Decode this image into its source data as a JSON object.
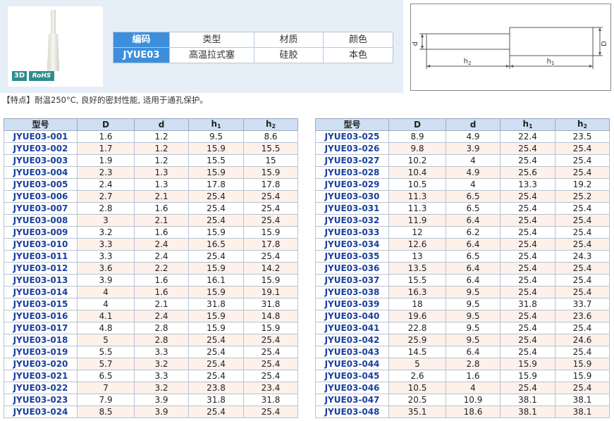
{
  "badges": {
    "three_d": "3D",
    "rohs": "RoHS"
  },
  "info_table": {
    "headers": [
      "编码",
      "类型",
      "材质",
      "颜色"
    ],
    "row": [
      "JYUE03",
      "高温拉式塞",
      "硅胶",
      "本色"
    ]
  },
  "drawing": {
    "d_label": "d",
    "D_label": "D",
    "h1_label": "h",
    "h1_sub": "1",
    "h2_label": "h",
    "h2_sub": "2"
  },
  "feature_note": "【特点】耐温250°C, 良好的密封性能, 适用于通孔保护。",
  "spec_headers": {
    "model": "型号",
    "D": "D",
    "d": "d",
    "h1": "h",
    "h1_sub": "1",
    "h2": "h",
    "h2_sub": "2"
  },
  "spec_left": [
    [
      "JYUE03-001",
      "1.6",
      "1.2",
      "9.5",
      "8.6"
    ],
    [
      "JYUE03-002",
      "1.7",
      "1.2",
      "15.9",
      "15.5"
    ],
    [
      "JYUE03-003",
      "1.9",
      "1.2",
      "15.5",
      "15"
    ],
    [
      "JYUE03-004",
      "2.3",
      "1.3",
      "15.9",
      "15.9"
    ],
    [
      "JYUE03-005",
      "2.4",
      "1.3",
      "17.8",
      "17.8"
    ],
    [
      "JYUE03-006",
      "2.7",
      "2.1",
      "25.4",
      "25.4"
    ],
    [
      "JYUE03-007",
      "2.8",
      "1.6",
      "25.4",
      "25.4"
    ],
    [
      "JYUE03-008",
      "3",
      "2.1",
      "25.4",
      "25.4"
    ],
    [
      "JYUE03-009",
      "3.2",
      "1.6",
      "15.9",
      "15.9"
    ],
    [
      "JYUE03-010",
      "3.3",
      "2.4",
      "16.5",
      "17.8"
    ],
    [
      "JYUE03-011",
      "3.3",
      "2.4",
      "25.4",
      "25.4"
    ],
    [
      "JYUE03-012",
      "3.6",
      "2.2",
      "15.9",
      "14.2"
    ],
    [
      "JYUE03-013",
      "3.9",
      "1.6",
      "16.1",
      "15.9"
    ],
    [
      "JYUE03-014",
      "4",
      "1.6",
      "15.9",
      "19.1"
    ],
    [
      "JYUE03-015",
      "4",
      "2.1",
      "31.8",
      "31.8"
    ],
    [
      "JYUE03-016",
      "4.1",
      "2.4",
      "15.9",
      "14.8"
    ],
    [
      "JYUE03-017",
      "4.8",
      "2.8",
      "15.9",
      "15.9"
    ],
    [
      "JYUE03-018",
      "5",
      "2.8",
      "25.4",
      "25.4"
    ],
    [
      "JYUE03-019",
      "5.5",
      "3.3",
      "25.4",
      "25.4"
    ],
    [
      "JYUE03-020",
      "5.7",
      "3.2",
      "25.4",
      "25.4"
    ],
    [
      "JYUE03-021",
      "6.5",
      "3.3",
      "25.4",
      "25.4"
    ],
    [
      "JYUE03-022",
      "7",
      "3.2",
      "23.8",
      "23.4"
    ],
    [
      "JYUE03-023",
      "7.9",
      "3.9",
      "31.8",
      "31.8"
    ],
    [
      "JYUE03-024",
      "8.5",
      "3.9",
      "25.4",
      "25.4"
    ]
  ],
  "spec_right": [
    [
      "JYUE03-025",
      "8.9",
      "4.9",
      "22.4",
      "23.5"
    ],
    [
      "JYUE03-026",
      "9.8",
      "3.9",
      "25.4",
      "25.4"
    ],
    [
      "JYUE03-027",
      "10.2",
      "4",
      "25.4",
      "25.4"
    ],
    [
      "JYUE03-028",
      "10.4",
      "4.9",
      "25.6",
      "25.4"
    ],
    [
      "JYUE03-029",
      "10.5",
      "4",
      "13.3",
      "19.2"
    ],
    [
      "JYUE03-030",
      "11.3",
      "6.5",
      "25.4",
      "25.2"
    ],
    [
      "JYUE03-031",
      "11.3",
      "6.5",
      "25.4",
      "25.4"
    ],
    [
      "JYUE03-032",
      "11.9",
      "6.4",
      "25.4",
      "25.4"
    ],
    [
      "JYUE03-033",
      "12",
      "6.2",
      "25.4",
      "25.4"
    ],
    [
      "JYUE03-034",
      "12.6",
      "6.4",
      "25.4",
      "25.4"
    ],
    [
      "JYUE03-035",
      "13",
      "6.5",
      "25.4",
      "24.3"
    ],
    [
      "JYUE03-036",
      "13.5",
      "6.4",
      "25.4",
      "25.4"
    ],
    [
      "JYUE03-037",
      "15.5",
      "6.4",
      "25.4",
      "25.4"
    ],
    [
      "JYUE03-038",
      "16.3",
      "9.5",
      "25.4",
      "25.4"
    ],
    [
      "JYUE03-039",
      "18",
      "9.5",
      "31.8",
      "33.7"
    ],
    [
      "JYUE03-040",
      "19.6",
      "9.5",
      "25.4",
      "23.6"
    ],
    [
      "JYUE03-041",
      "22.8",
      "9.5",
      "25.4",
      "25.4"
    ],
    [
      "JYUE03-042",
      "25.9",
      "9.5",
      "25.4",
      "24.6"
    ],
    [
      "JYUE03-043",
      "14.5",
      "6.4",
      "25.4",
      "25.4"
    ],
    [
      "JYUE03-044",
      "5",
      "2.8",
      "15.9",
      "15.9"
    ],
    [
      "JYUE03-045",
      "2.6",
      "1.6",
      "15.9",
      "15.9"
    ],
    [
      "JYUE03-046",
      "10.5",
      "4",
      "25.4",
      "25.4"
    ],
    [
      "JYUE03-047",
      "20.5",
      "10.9",
      "38.1",
      "38.1"
    ],
    [
      "JYUE03-048",
      "35.1",
      "18.6",
      "38.1",
      "38.1"
    ]
  ]
}
